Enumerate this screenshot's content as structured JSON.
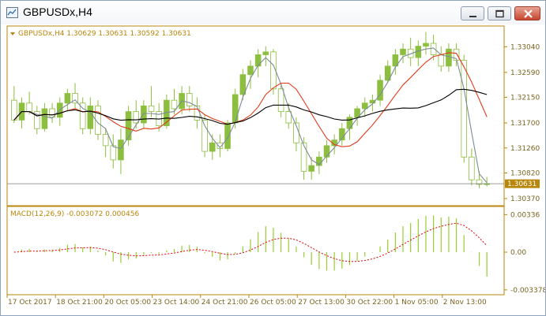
{
  "window": {
    "title": "GBPUSDx,H4"
  },
  "header": {
    "label": "GBPUSDx,H4  1.30629 1.30631 1.30592 1.30631"
  },
  "macd": {
    "label": "MACD(12,26,9) -0.003072 0.000456"
  },
  "colors": {
    "axis": "#b8860b",
    "text": "#7a6420",
    "bull_candle": "#8cbf3f",
    "bear_candle": "#ffffff",
    "ma_fast": "#7d8b99",
    "ma_mid": "#e03a1a",
    "ma_slow": "#000000",
    "macd_hist": "#9acd32",
    "macd_signal": "#e00000",
    "price_tag_bg": "#b8860b"
  },
  "chart_data": {
    "type": "candlestick",
    "price_axis_ticks": [
      "1.33040",
      "1.32590",
      "1.32150",
      "1.31700",
      "1.31260",
      "1.30820",
      "1.30370"
    ],
    "current_price_label": "1.30631",
    "current_price": 1.30631,
    "macd_axis_ticks": [
      "0.00336",
      "0.00",
      "-0.003378"
    ],
    "time_axis_labels": [
      "17 Oct 2017",
      "18 Oct 21:00",
      "20 Oct 05:00",
      "23 Oct 14:00",
      "24 Oct 21:00",
      "26 Oct 05:00",
      "27 Oct 13:00",
      "30 Oct 22:00",
      "1 Nov 05:00",
      "2 Nov 13:00"
    ],
    "price_range": [
      1.303,
      1.3335
    ],
    "macd_range": [
      -0.0036,
      0.0036
    ],
    "candles": [
      [
        1.321,
        1.3235,
        1.317,
        1.3175
      ],
      [
        1.3175,
        1.3215,
        1.316,
        1.3205
      ],
      [
        1.3205,
        1.3225,
        1.3185,
        1.319
      ],
      [
        1.319,
        1.32,
        1.315,
        1.316
      ],
      [
        1.316,
        1.3205,
        1.3155,
        1.3195
      ],
      [
        1.3195,
        1.3205,
        1.317,
        1.318
      ],
      [
        1.318,
        1.3215,
        1.3165,
        1.3205
      ],
      [
        1.3205,
        1.323,
        1.319,
        1.3222
      ],
      [
        1.3222,
        1.324,
        1.3195,
        1.3205
      ],
      [
        1.3205,
        1.3215,
        1.315,
        1.316
      ],
      [
        1.316,
        1.3215,
        1.315,
        1.32
      ],
      [
        1.32,
        1.321,
        1.314,
        1.315
      ],
      [
        1.315,
        1.316,
        1.311,
        1.313
      ],
      [
        1.313,
        1.315,
        1.309,
        1.3105
      ],
      [
        1.3105,
        1.316,
        1.308,
        1.314
      ],
      [
        1.314,
        1.32,
        1.313,
        1.319
      ],
      [
        1.319,
        1.321,
        1.316,
        1.317
      ],
      [
        1.317,
        1.321,
        1.316,
        1.32
      ],
      [
        1.32,
        1.3235,
        1.318,
        1.319
      ],
      [
        1.319,
        1.3205,
        1.3155,
        1.3165
      ],
      [
        1.3165,
        1.322,
        1.316,
        1.321
      ],
      [
        1.321,
        1.323,
        1.3185,
        1.3195
      ],
      [
        1.3195,
        1.3235,
        1.3185,
        1.3222
      ],
      [
        1.3222,
        1.3235,
        1.319,
        1.32
      ],
      [
        1.32,
        1.3215,
        1.316,
        1.3175
      ],
      [
        1.3175,
        1.3185,
        1.311,
        1.312
      ],
      [
        1.312,
        1.315,
        1.3105,
        1.3135
      ],
      [
        1.3135,
        1.315,
        1.311,
        1.3125
      ],
      [
        1.3125,
        1.3175,
        1.312,
        1.317
      ],
      [
        1.317,
        1.323,
        1.316,
        1.322
      ],
      [
        1.322,
        1.3265,
        1.321,
        1.3255
      ],
      [
        1.3255,
        1.328,
        1.323,
        1.327
      ],
      [
        1.327,
        1.33,
        1.325,
        1.329
      ],
      [
        1.329,
        1.3305,
        1.327,
        1.3295
      ],
      [
        1.3295,
        1.33,
        1.322,
        1.323
      ],
      [
        1.323,
        1.324,
        1.318,
        1.319
      ],
      [
        1.319,
        1.3205,
        1.316,
        1.317
      ],
      [
        1.317,
        1.318,
        1.312,
        1.3135
      ],
      [
        1.3135,
        1.3145,
        1.307,
        1.3085
      ],
      [
        1.3085,
        1.311,
        1.307,
        1.3095
      ],
      [
        1.3095,
        1.312,
        1.308,
        1.311
      ],
      [
        1.311,
        1.314,
        1.31,
        1.313
      ],
      [
        1.313,
        1.315,
        1.3115,
        1.314
      ],
      [
        1.314,
        1.317,
        1.313,
        1.316
      ],
      [
        1.316,
        1.3185,
        1.314,
        1.318
      ],
      [
        1.318,
        1.32,
        1.3165,
        1.3195
      ],
      [
        1.3195,
        1.3215,
        1.318,
        1.3205
      ],
      [
        1.3205,
        1.322,
        1.319,
        1.321
      ],
      [
        1.321,
        1.3255,
        1.32,
        1.3245
      ],
      [
        1.3245,
        1.328,
        1.324,
        1.327
      ],
      [
        1.327,
        1.33,
        1.3255,
        1.329
      ],
      [
        1.329,
        1.331,
        1.3275,
        1.33
      ],
      [
        1.33,
        1.332,
        1.327,
        1.3285
      ],
      [
        1.3285,
        1.3315,
        1.327,
        1.3305
      ],
      [
        1.3305,
        1.333,
        1.329,
        1.331
      ],
      [
        1.331,
        1.3325,
        1.328,
        1.329
      ],
      [
        1.329,
        1.3305,
        1.326,
        1.327
      ],
      [
        1.327,
        1.331,
        1.326,
        1.33
      ],
      [
        1.33,
        1.331,
        1.327,
        1.328
      ],
      [
        1.328,
        1.329,
        1.31,
        1.311
      ],
      [
        1.311,
        1.3125,
        1.306,
        1.307
      ],
      [
        1.307,
        1.3085,
        1.3055,
        1.3062
      ],
      [
        1.3062,
        1.3075,
        1.3058,
        1.3063
      ]
    ]
  }
}
